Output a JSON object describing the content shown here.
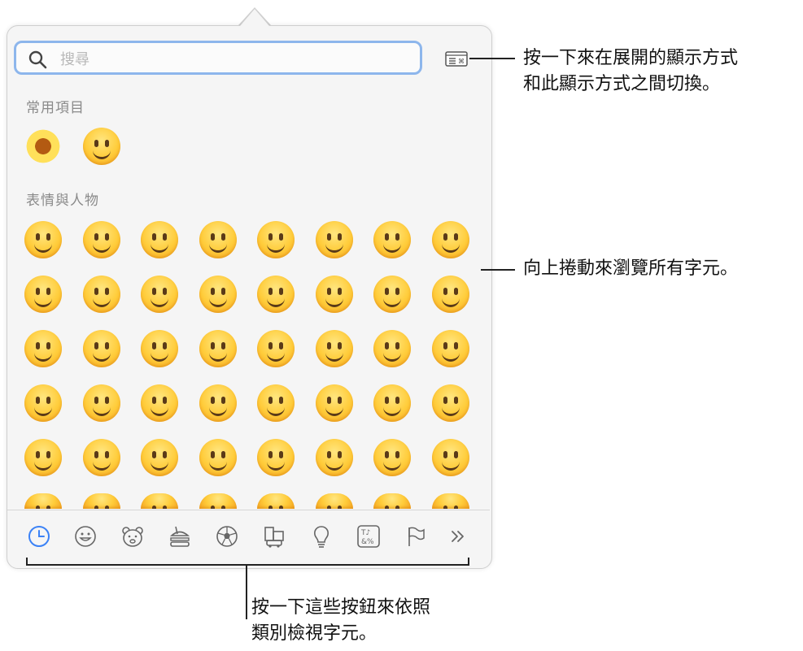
{
  "search": {
    "placeholder": "搜尋",
    "value": ""
  },
  "sections": {
    "frequent_title": "常用項目",
    "smileys_title": "表情與人物"
  },
  "frequent_emoji": [
    "🌼",
    "😫"
  ],
  "smileys_emoji": [
    "😀",
    "😃",
    "😄",
    "😁",
    "😆",
    "😅",
    "😂",
    "🤣",
    "☺️",
    "🥲",
    "😊",
    "😇",
    "🙂",
    "🙃",
    "😉",
    "😌",
    "😍",
    "🥰",
    "😘",
    "😗",
    "😙",
    "😚",
    "😋",
    "😛",
    "😝",
    "😜",
    "🤪",
    "🤨",
    "🧐",
    "🤓",
    "😎",
    "🥸",
    "🤩",
    "🥳",
    "😏",
    "😒",
    "😞",
    "😔",
    "😟",
    "😕",
    "🙁",
    "☹️",
    "😣",
    "😖",
    "😫",
    "😩",
    "🥺",
    "😢"
  ],
  "category_tabs": [
    {
      "name": "frequently-used",
      "icon": "clock-icon",
      "active": true
    },
    {
      "name": "smileys-people",
      "icon": "smiley-icon",
      "active": false
    },
    {
      "name": "animals-nature",
      "icon": "bear-icon",
      "active": false
    },
    {
      "name": "food-drink",
      "icon": "burger-icon",
      "active": false
    },
    {
      "name": "activity",
      "icon": "soccer-ball-icon",
      "active": false
    },
    {
      "name": "travel-places",
      "icon": "building-car-icon",
      "active": false
    },
    {
      "name": "objects",
      "icon": "lightbulb-icon",
      "active": false
    },
    {
      "name": "symbols",
      "icon": "symbols-icon",
      "active": false
    },
    {
      "name": "flags",
      "icon": "flag-icon",
      "active": false
    },
    {
      "name": "more",
      "icon": "chevron-double-right-icon",
      "active": false
    }
  ],
  "callouts": {
    "toggle_line1": "按一下來在展開的顯示方式",
    "toggle_line2": "和此顯示方式之間切換。",
    "scroll": "向上捲動來瀏覽所有字元。",
    "tabs_line1": "按一下這些按鈕來依照",
    "tabs_line2": "類別檢視字元。"
  },
  "colors": {
    "accent": "#3b82f6",
    "search_border": "#8db6ec",
    "panel_bg": "#f5f5f5"
  }
}
